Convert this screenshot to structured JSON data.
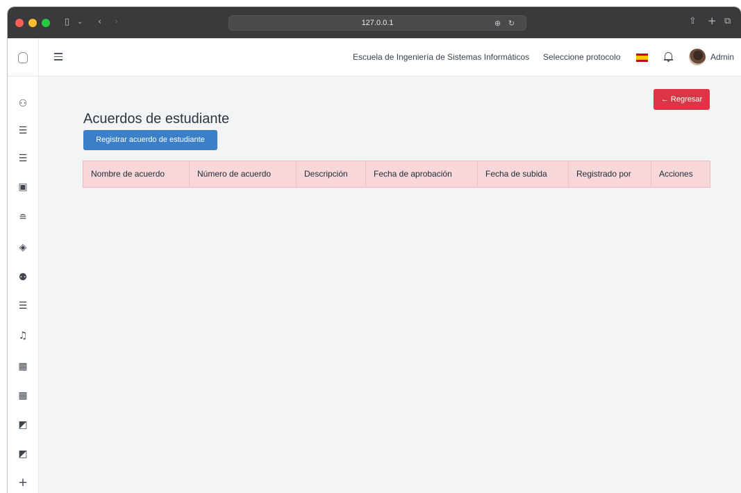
{
  "browser": {
    "url": "127.0.0.1"
  },
  "navbar": {
    "school": "Escuela de Ingeniería de Sistemas Informáticos",
    "protocol_select": "Seleccione protocolo",
    "user_name": "Admin"
  },
  "page": {
    "back_button": "← Regresar",
    "title": "Acuerdos de estudiante",
    "register_button": "Registrar acuerdo de estudiante"
  },
  "table": {
    "columns": [
      "Nombre de acuerdo",
      "Número de acuerdo",
      "Descripción",
      "Fecha de aprobación",
      "Fecha de subida",
      "Registrado por",
      "Acciones"
    ],
    "rows": []
  },
  "sidebar": {
    "icons": [
      "add-user-icon",
      "user-list-icon",
      "user-list-icon",
      "document-icon",
      "archive-icon",
      "support-icon",
      "users-group-icon",
      "user-list-icon",
      "bell-icon",
      "calendar-icon",
      "calendar-icon",
      "thumbs-down-icon",
      "thumbs-down-icon",
      "plus-icon"
    ]
  },
  "colors": {
    "back_button": "#dc3545",
    "register_button": "#3a7fc8",
    "table_header": "#f8d7da"
  }
}
